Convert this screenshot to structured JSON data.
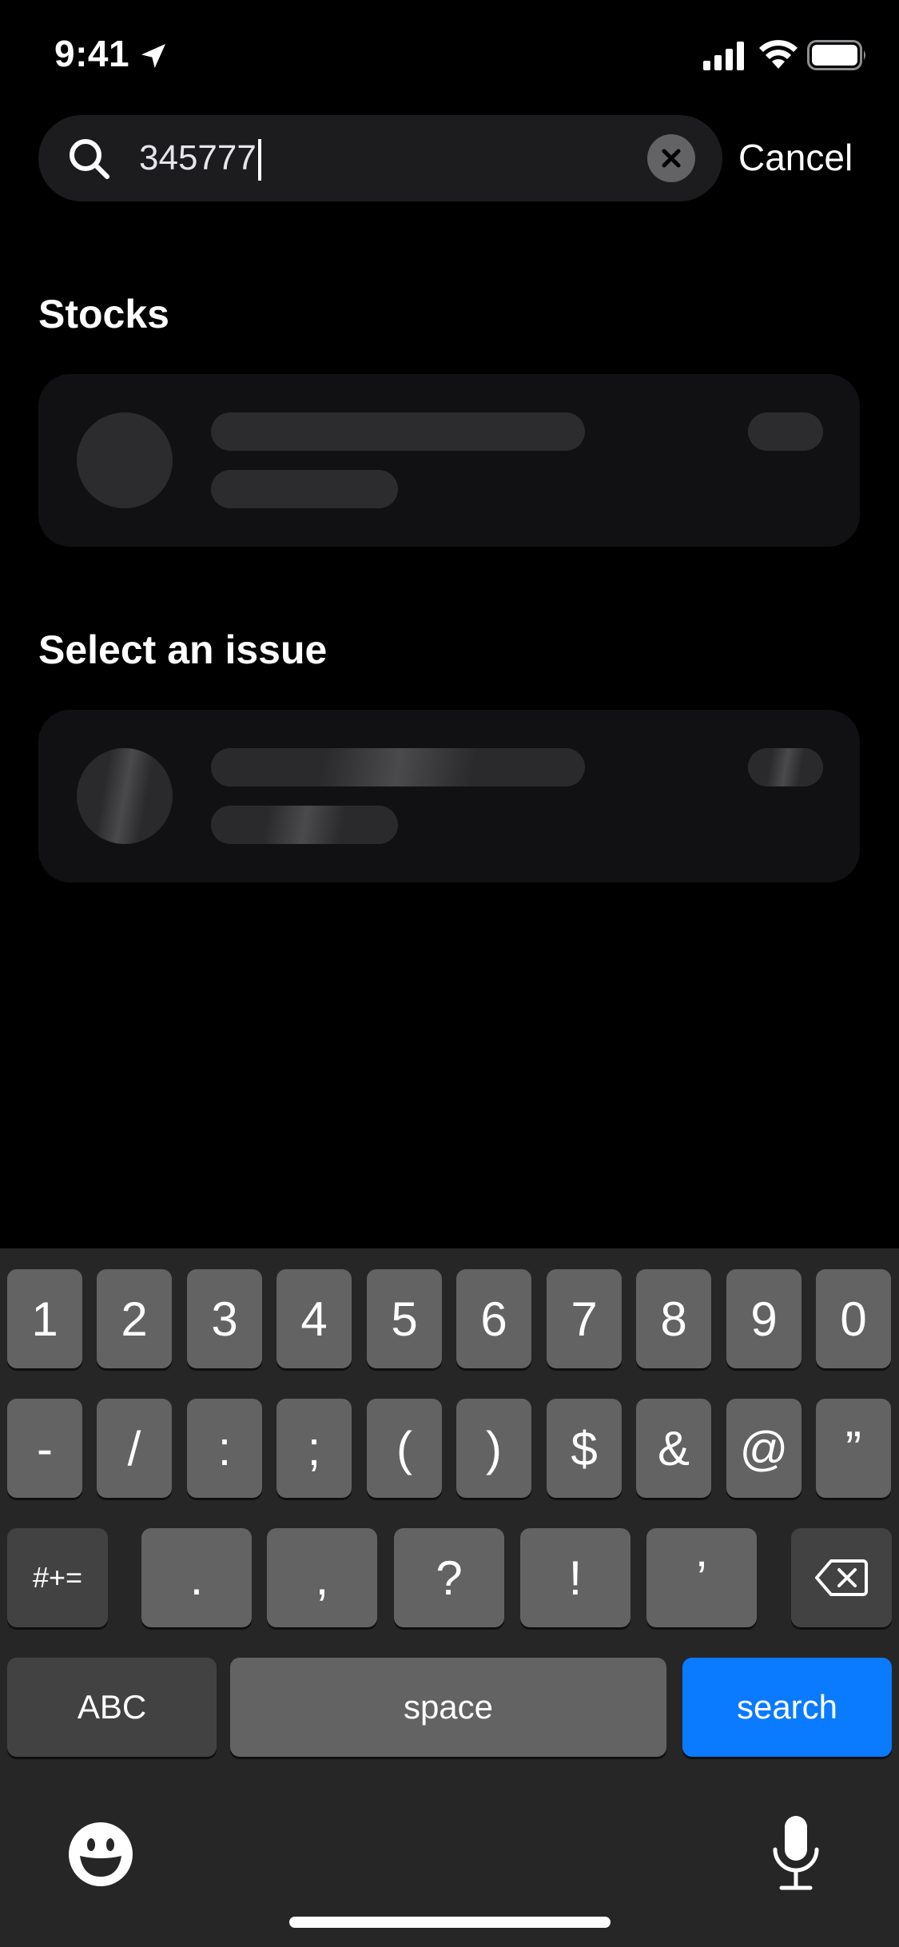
{
  "status_bar": {
    "time": "9:41"
  },
  "search": {
    "query": "345777",
    "cancel_label": "Cancel"
  },
  "sections": [
    {
      "title": "Stocks"
    },
    {
      "title": "Select an issue"
    }
  ],
  "keyboard": {
    "row1": [
      "1",
      "2",
      "3",
      "4",
      "5",
      "6",
      "7",
      "8",
      "9",
      "0"
    ],
    "row2": [
      "-",
      "/",
      ":",
      ";",
      "(",
      ")",
      "$",
      "&",
      "@",
      "”"
    ],
    "row3_left": "#+=",
    "row3_mid": [
      ".",
      ",",
      "?",
      "!",
      "’"
    ],
    "abc_label": "ABC",
    "space_label": "space",
    "search_label": "search"
  },
  "colors": {
    "accent": "#0a7aff",
    "background": "#000000",
    "keyboard_bg": "#262626"
  }
}
